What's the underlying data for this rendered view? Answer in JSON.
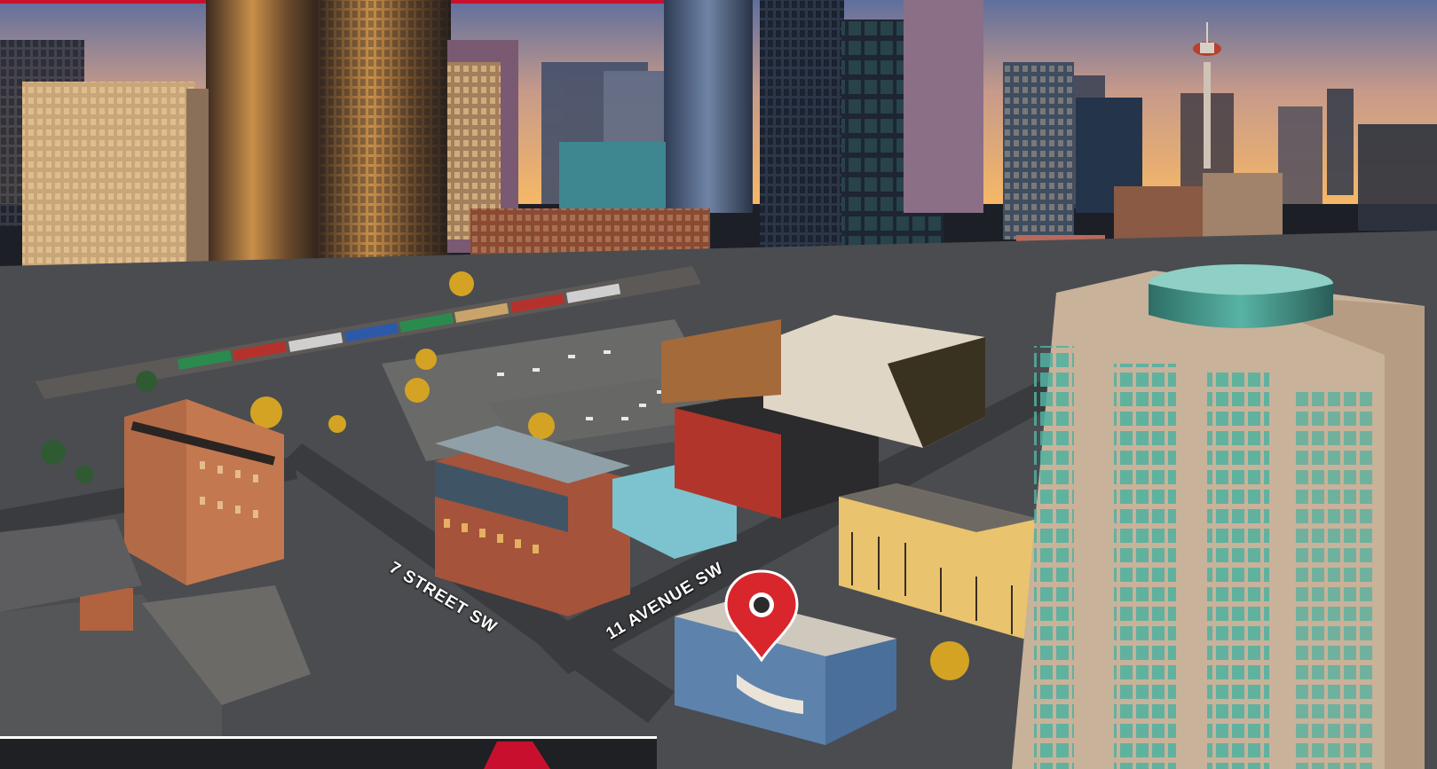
{
  "scene": {
    "subject": "aerial photo of downtown Calgary at sunset with a location pin"
  },
  "street_labels": {
    "seventh_street": "7 STREET SW",
    "eleventh_avenue": "11 AVENUE SW"
  },
  "colors": {
    "pin_red": "#d8262c",
    "sky_top": "#6b7aa8",
    "sky_horizon": "#f6b866",
    "top_accent_bar": "#c8102e"
  }
}
